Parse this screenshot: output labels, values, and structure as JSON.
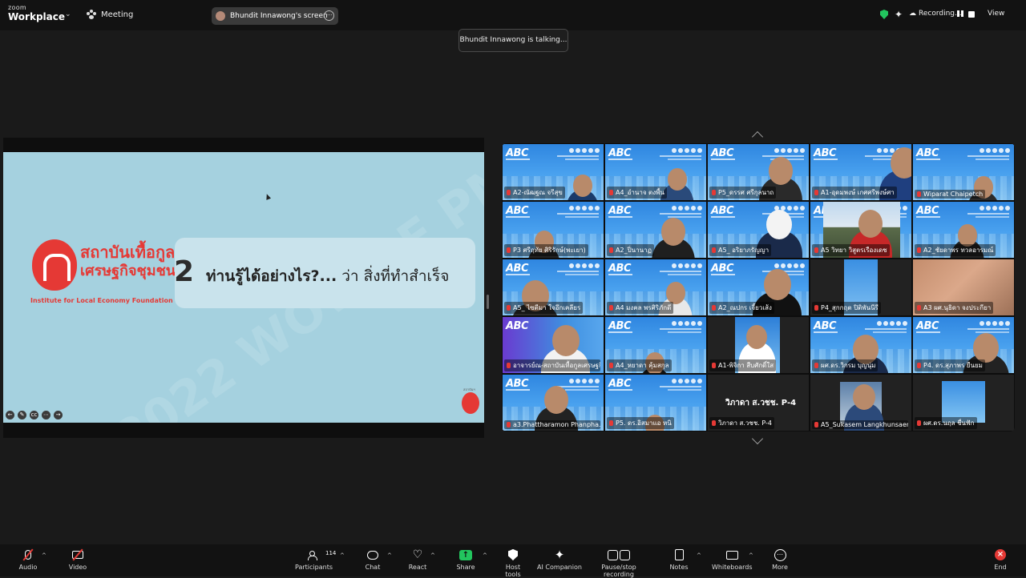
{
  "app": {
    "brand_top": "zoom",
    "brand_bottom": "Workplace",
    "meeting_label": "Meeting"
  },
  "screen_share": {
    "label": "Bhundit Innawong's screen",
    "more": "⋯"
  },
  "status": {
    "recording": "Recording...",
    "view": "View"
  },
  "talking": "Bhundit Innawong is talking...",
  "slide": {
    "org_th_1": "สถาบันเทื้อกูล",
    "org_th_2": "เศรษฐกิจชุมชน",
    "org_en": "Institute for Local Economy Foundation",
    "question_number": "2",
    "question_bold": "ท่านรู้ได้อย่างไร?...",
    "question_rest": " ว่า สิ่งที่ทำสำเร็จ",
    "watermark": "©2022 WOW LE PMUA",
    "mini_logo_text": "สถาบันฯ"
  },
  "gallery": [
    {
      "name": "A2-ณัฒฐณ จรีสุข"
    },
    {
      "name": "A4_อำนาจ ตงพื้น"
    },
    {
      "name": "P5_ดรรศ ศรีกุลนาถ"
    },
    {
      "name": "A1-อุดมพงษ์ เกศศรีพงษ์ศา"
    },
    {
      "name": "Wiparat Chaipetch"
    },
    {
      "name": "P3 ศรีฤทัย ศิริรักษ์(พะเยา)"
    },
    {
      "name": "A2_ปิ่นานาฏ"
    },
    {
      "name": "A5_ อริยาภรัญญา"
    },
    {
      "name": "A5 วิทยา วิสูตรเรืองเดช"
    },
    {
      "name": "A2_ชัยดาพร ทวลอารมณ์"
    },
    {
      "name": "A5_ ไซตีมา ใจอึกเคลียร"
    },
    {
      "name": "A4 มงคล พรศิริภักดี"
    },
    {
      "name": "A2_ณปกร เจี้ยวเส้ง"
    },
    {
      "name": "P4_สุกกฤต ปิติพันนีรี"
    },
    {
      "name": "A3 ผศ.นุธิดา จงประกียา"
    },
    {
      "name": "อาจารย์ณ-สถาบันเทื้อกูลเศรษฐกิ..."
    },
    {
      "name": "A4_หยาดา คุ้มสกุล"
    },
    {
      "name": "A1-พิจิกา สืบศักดิ์ใส"
    },
    {
      "name": "ผศ.ดร.วิกรม บุญนุ่ม"
    },
    {
      "name": "P4. ดร.สุภาพร ยืนยม"
    },
    {
      "name": "a3.Phattharamon Phanpha..."
    },
    {
      "name": "P5. ดร.อิสมาแอ หนิ"
    },
    {
      "name": "วิภาดา ส.วชช. P-4",
      "big": "วิภาดา ส.วชช. P-4"
    },
    {
      "name": "A5_Sukasem Langkhunsaen"
    },
    {
      "name": "ผศ.ดร.นฤล ชื่นฟัก"
    }
  ],
  "toolbar": {
    "audio": "Audio",
    "video": "Video",
    "participants": "Participants",
    "participants_count": "114",
    "chat": "Chat",
    "react": "React",
    "share": "Share",
    "host_tools": "Host tools",
    "ai_companion": "AI Companion",
    "pause_stop_recording": "Pause/stop recording",
    "notes": "Notes",
    "whiteboards": "Whiteboards",
    "more": "More",
    "end": "End"
  }
}
